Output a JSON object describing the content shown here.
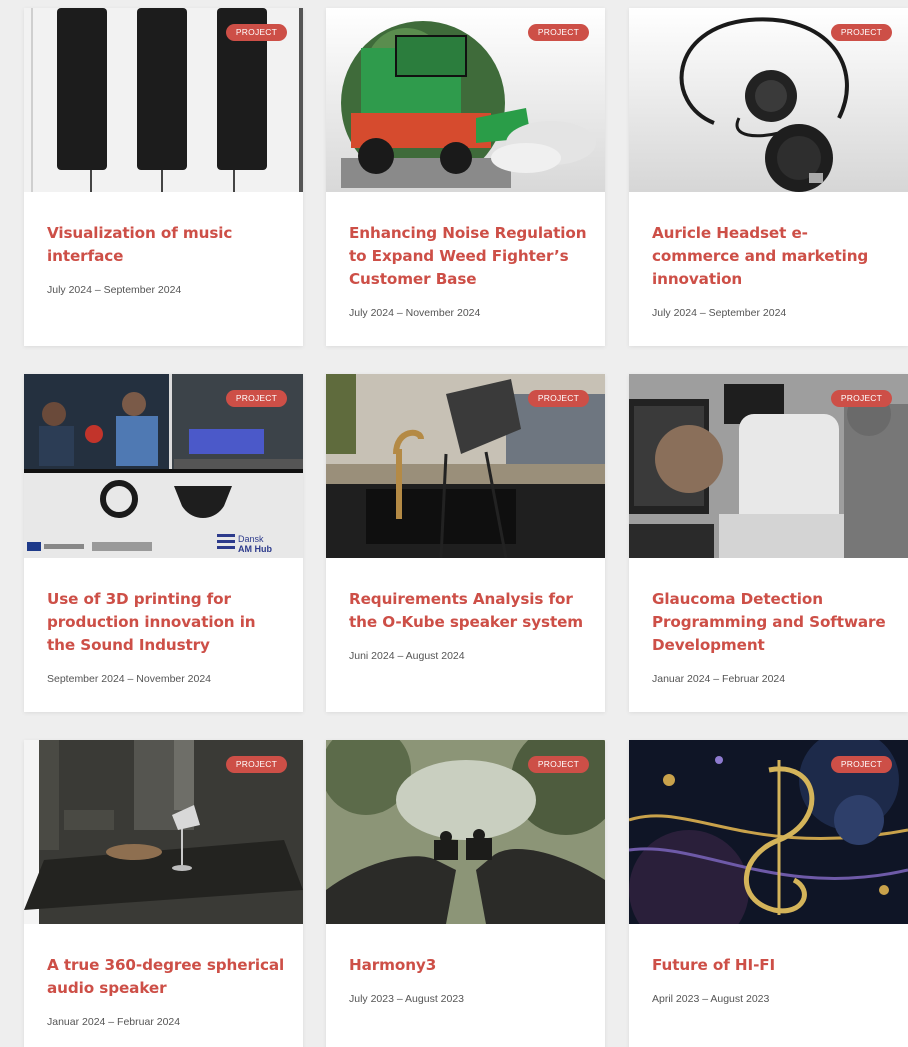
{
  "badge_label": "PROJECT",
  "accent_color": "#cd4f47",
  "cards": [
    {
      "title": "Visualization of music interface",
      "date": "July 2024 – September 2024",
      "image": "piano-keys"
    },
    {
      "title": "Enhancing Noise Regulation to Expand Weed Fighter’s Customer Base",
      "date": "July 2024 – November 2024",
      "image": "weed-fighter-vehicle"
    },
    {
      "title": "Auricle Headset e-commerce and marketing innovation",
      "date": "July 2024 – September 2024",
      "image": "headset"
    },
    {
      "title": "Use of 3D printing for production innovation in the Sound Industry",
      "date": "September 2024 – November 2024",
      "image": "3d-printing-collage",
      "logo_text": "Dansk AM Hub"
    },
    {
      "title": "Requirements Analysis for the O-Kube speaker system",
      "date": "Juni 2024 – August 2024",
      "image": "o-kube-speaker"
    },
    {
      "title": "Glaucoma Detection Programming and Software Development",
      "date": "Januar 2024 – Februar 2024",
      "image": "eye-scanner"
    },
    {
      "title": "A true 360-degree spherical audio speaker",
      "date": "Januar 2024 – Februar 2024",
      "image": "dark-room-speaker"
    },
    {
      "title": "Harmony3",
      "date": "July 2023 – August 2023",
      "image": "puzzle-hands"
    },
    {
      "title": "Future of HI-FI",
      "date": "April 2023 – August 2023",
      "image": "music-notes"
    }
  ]
}
